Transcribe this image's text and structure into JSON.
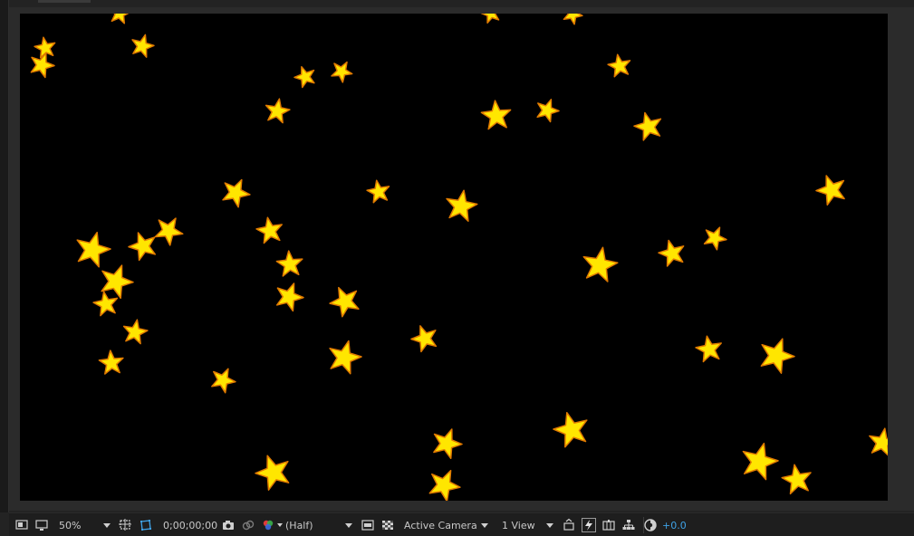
{
  "viewer": {
    "background_color": "#000000",
    "star_fill": "#ffe600",
    "star_stroke": "#e07a00"
  },
  "toolbar": {
    "zoom": "50%",
    "timecode": "0;00;00;00",
    "resolution": "(Half)",
    "camera": "Active Camera",
    "views": "1 View",
    "exposure": "+0.0"
  },
  "icons": {
    "always_preview": "monitor-preview-icon",
    "display": "display-icon",
    "region_of_interest": "region-of-interest-icon",
    "mask_path": "mask-visibility-icon",
    "snapshot": "camera-snapshot-icon",
    "show_snapshot": "show-snapshot-icon",
    "channels": "rgb-channels-icon",
    "fast_previews": "fast-previews-icon",
    "transparency_grid": "transparency-grid-icon",
    "reset_exposure": "reset-exposure-icon",
    "fast_draft": "lightning-icon",
    "timeline": "timeline-icon",
    "flowchart": "flowchart-icon",
    "exposure": "exposure-icon"
  }
}
